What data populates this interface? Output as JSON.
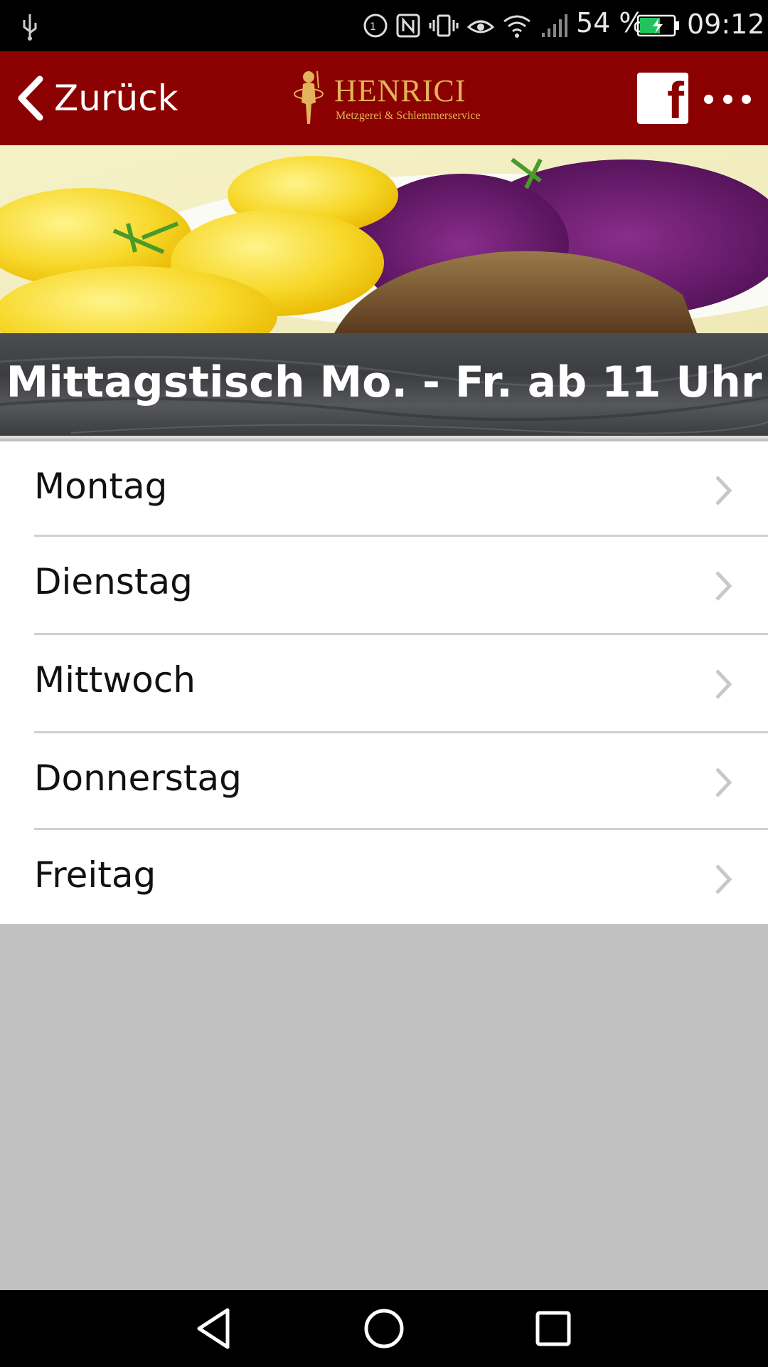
{
  "status_bar": {
    "battery_percent": "54 %",
    "time": "09:12",
    "icons": [
      "usb-icon",
      "data-saver-icon",
      "nfc-icon",
      "vibrate-icon",
      "eye-comfort-icon",
      "wifi-icon",
      "signal-icon",
      "battery-charging-icon"
    ]
  },
  "header": {
    "back_label": "Zurück",
    "logo_title": "HENRICI",
    "logo_subtitle": "Metzgerei & Schlemmerservice",
    "accent_color": "#8b0000",
    "logo_color": "#e3b25a"
  },
  "banner": {
    "title": "Mittagstisch Mo. - Fr. ab 11 Uhr"
  },
  "days": [
    {
      "label": "Montag"
    },
    {
      "label": "Dienstag"
    },
    {
      "label": "Mittwoch"
    },
    {
      "label": "Donnerstag"
    },
    {
      "label": "Freitag"
    }
  ]
}
